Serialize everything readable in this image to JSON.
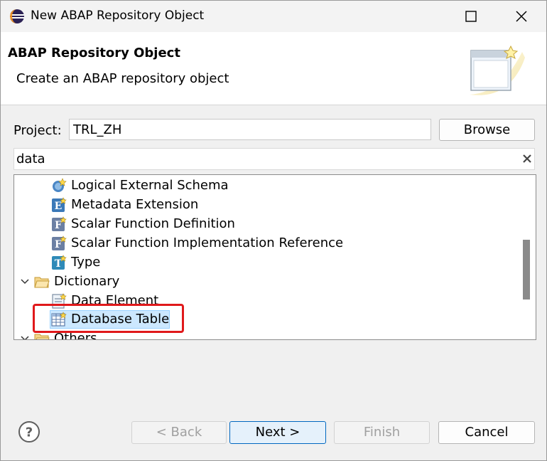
{
  "window": {
    "title": "New ABAP Repository Object"
  },
  "header": {
    "title": "ABAP Repository Object",
    "description": "Create an ABAP repository object"
  },
  "project": {
    "label": "Project:",
    "value": "TRL_ZH",
    "browse_label": "Browse"
  },
  "filter": {
    "value": "data"
  },
  "tree": {
    "items": [
      {
        "label": "Logical External Schema",
        "icon": "schema-icon"
      },
      {
        "label": "Metadata Extension",
        "icon": "metadata-extension-icon"
      },
      {
        "label": "Scalar Function Definition",
        "icon": "function-icon"
      },
      {
        "label": "Scalar Function Implementation Reference",
        "icon": "function-icon"
      },
      {
        "label": "Type",
        "icon": "type-icon"
      },
      {
        "label": "Dictionary",
        "icon": "folder-icon",
        "expanded": true
      },
      {
        "label": "Data Element",
        "icon": "data-element-icon"
      },
      {
        "label": "Database Table",
        "icon": "table-icon",
        "selected": true
      },
      {
        "label": "Others",
        "icon": "folder-icon",
        "expanded": true
      }
    ]
  },
  "buttons": {
    "back": "< Back",
    "next": "Next >",
    "finish": "Finish",
    "cancel": "Cancel"
  },
  "colors": {
    "highlight": "#e0191b",
    "selection": "#cce8ff",
    "default_button_border": "#0067c0"
  }
}
